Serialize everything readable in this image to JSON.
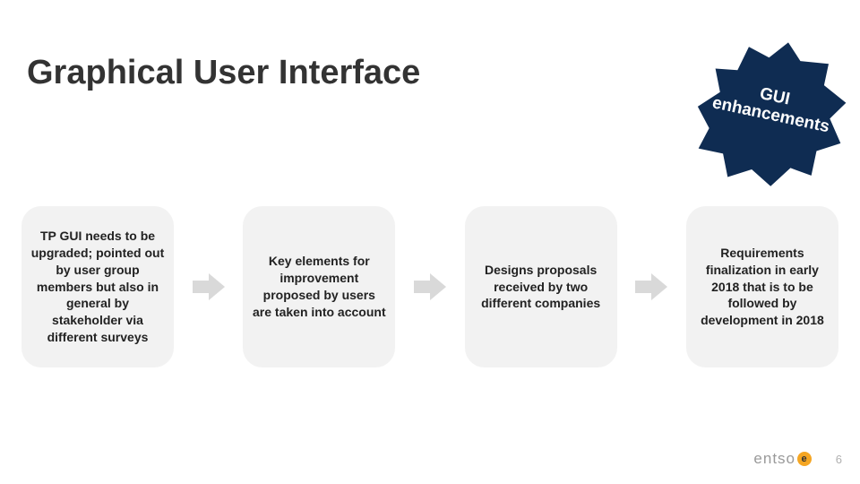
{
  "title": "Graphical User Interface",
  "badge": {
    "line1": "GUI",
    "line2": "enhancements",
    "fill": "#0f2c52"
  },
  "cards": [
    "TP GUI needs to be upgraded; pointed out by user group members but also in general by stakeholder via different surveys",
    "Key elements for improvement proposed by users are taken into account",
    "Designs proposals received by two different companies",
    "Requirements finalization in early 2018 that is to be followed by development in 2018"
  ],
  "arrow_fill": "#d9d9d9",
  "footer": {
    "brand_prefix": "entso",
    "brand_badge": "e"
  },
  "page_number": "6"
}
